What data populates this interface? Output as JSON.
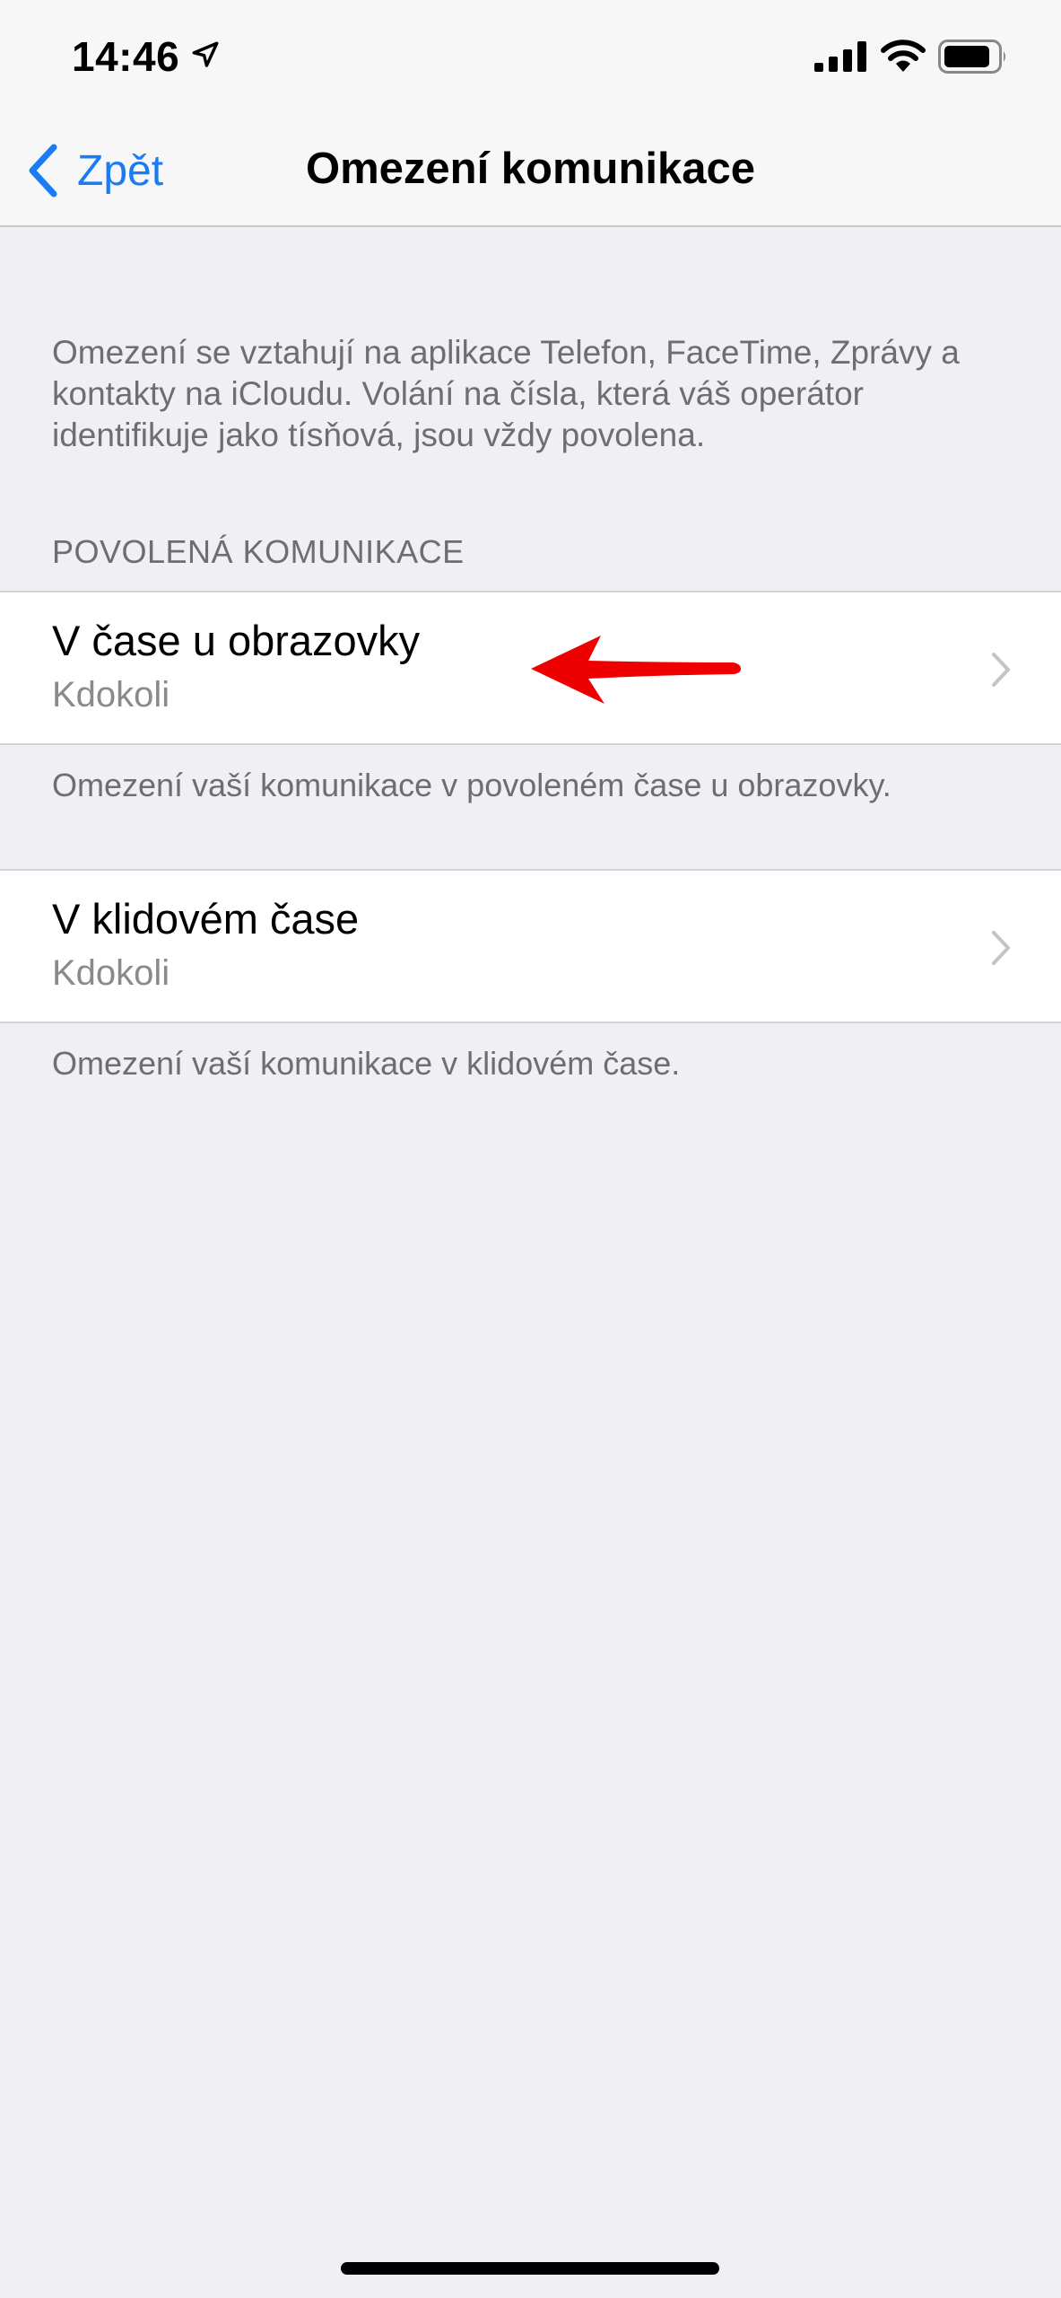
{
  "status_bar": {
    "time": "14:46"
  },
  "nav": {
    "back_label": "Zpět",
    "title": "Omezení komunikace"
  },
  "description": "Omezení se vztahují na aplikace Telefon, FaceTime, Zprávy a kontakty na iCloudu. Volání na čísla, která váš operátor identifikuje jako tísňová, jsou vždy povolena.",
  "section": {
    "header": "POVOLENÁ KOMUNIKACE",
    "items": [
      {
        "title": "V čase u obrazovky",
        "value": "Kdokoli",
        "footer": "Omezení vaší komunikace v povoleném čase u obrazovky."
      },
      {
        "title": "V klidovém čase",
        "value": "Kdokoli",
        "footer": "Omezení vaší komunikace v klidovém čase."
      }
    ]
  },
  "colors": {
    "accent": "#1a7cf5",
    "background": "#efeff4",
    "annotation": "#ee0000"
  },
  "icons": {
    "location": "location-arrow-icon",
    "signal": "cellular-signal-icon",
    "wifi": "wifi-icon",
    "battery": "battery-icon",
    "back": "chevron-left-icon",
    "disclosure": "chevron-right-icon",
    "annotation": "red-arrow-icon"
  }
}
